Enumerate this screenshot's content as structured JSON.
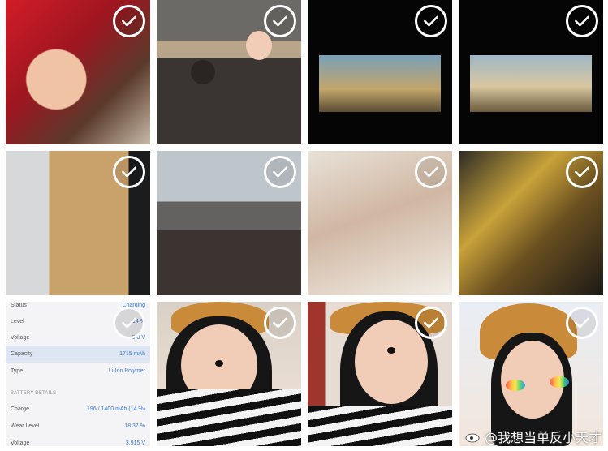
{
  "gallery": {
    "tiles": [
      {
        "alt": "photo-selfie-cinema"
      },
      {
        "alt": "photo-movie-scene"
      },
      {
        "alt": "photo-cinema-screen-1"
      },
      {
        "alt": "photo-cinema-screen-2"
      },
      {
        "alt": "photo-sandwich-box"
      },
      {
        "alt": "photo-street-station"
      },
      {
        "alt": "photo-fruit-sandwich"
      },
      {
        "alt": "photo-snack-package"
      },
      {
        "alt": "screenshot-battery-info"
      },
      {
        "alt": "photo-selfie-filter-1"
      },
      {
        "alt": "photo-selfie-filter-2"
      },
      {
        "alt": "photo-selfie-filter-3"
      }
    ],
    "check_icon": "checkmark-icon"
  },
  "battery_screen": {
    "rows": [
      {
        "label": "Status",
        "value": "Charging"
      },
      {
        "label": "Level",
        "value": "14 %"
      },
      {
        "label": "Voltage",
        "value": "3.8 V"
      },
      {
        "label": "Capacity",
        "value": "1715 mAh"
      },
      {
        "label": "Type",
        "value": "Li-Ion Polymer"
      }
    ],
    "section_title": "BATTERY DETAILS",
    "details": [
      {
        "label": "Charge",
        "value": "196 / 1400 mAh (14 %)"
      },
      {
        "label": "Wear Level",
        "value": "18.37 %"
      },
      {
        "label": "Voltage",
        "value": "3.915 V"
      }
    ]
  },
  "watermark": {
    "text": "@我想当单反小天才",
    "icon": "weibo-icon"
  },
  "colors": {
    "check": "#ffffff",
    "accent_blue": "#3b77d6",
    "highlight_row": "#dde6f2"
  }
}
